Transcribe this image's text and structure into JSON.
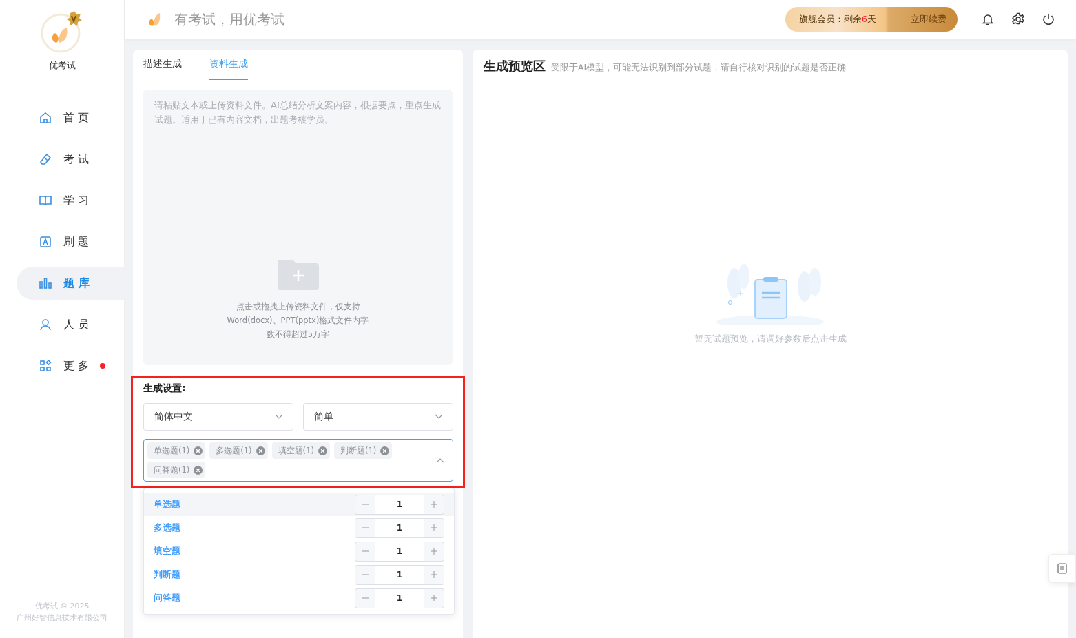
{
  "app": {
    "name": "优考试",
    "footer_line_1": "优考试 © 2025",
    "footer_line_2": "广州好智信息技术有限公司"
  },
  "sidebar": {
    "items": [
      {
        "label": "首 页",
        "selected": false,
        "badge": false
      },
      {
        "label": "考 试",
        "selected": false,
        "badge": false
      },
      {
        "label": "学 习",
        "selected": false,
        "badge": false
      },
      {
        "label": "刷 题",
        "selected": false,
        "badge": false
      },
      {
        "label": "题 库",
        "selected": true,
        "badge": false
      },
      {
        "label": "人 员",
        "selected": false,
        "badge": false
      },
      {
        "label": "更 多",
        "selected": false,
        "badge": true
      }
    ]
  },
  "header": {
    "slogan": "有考试，用优考试",
    "membership": {
      "prefix": "旗舰会员：剩余",
      "days": "6",
      "suffix": "天"
    },
    "renew_button": "立即续费"
  },
  "tabs": [
    {
      "label": "描述生成",
      "selected": false
    },
    {
      "label": "资料生成",
      "selected": true
    }
  ],
  "material": {
    "placeholder": "请粘贴文本或上传资料文件。AI总结分析文案内容，根据要点，重点生成试题。适用于已有内容文档，出题考核学员。",
    "upload_hint": [
      "点击或拖拽上传资料文件，仅支持",
      "Word(docx)、PPT(pptx)格式文件内字",
      "数不得超过5万字"
    ]
  },
  "settings": {
    "title": "生成设置:",
    "language": "简体中文",
    "difficulty": "简单",
    "question_types": [
      "单选题(1)",
      "多选题(1)",
      "填空题(1)",
      "判断题(1)",
      "问答题(1)"
    ],
    "expanded": true
  },
  "dropdown": [
    {
      "label": "单选题",
      "value": "1",
      "highlighted": true
    },
    {
      "label": "多选题",
      "value": "1",
      "highlighted": false
    },
    {
      "label": "填空题",
      "value": "1",
      "highlighted": false
    },
    {
      "label": "判断题",
      "value": "1",
      "highlighted": false
    },
    {
      "label": "问答题",
      "value": "1",
      "highlighted": false
    }
  ],
  "preview": {
    "title": "生成预览区",
    "note": "受限于AI模型，可能无法识别到部分试题，请自行核对识别的试题是否正确",
    "empty_text": "暂无试题预览，请调好参数后点击生成"
  }
}
